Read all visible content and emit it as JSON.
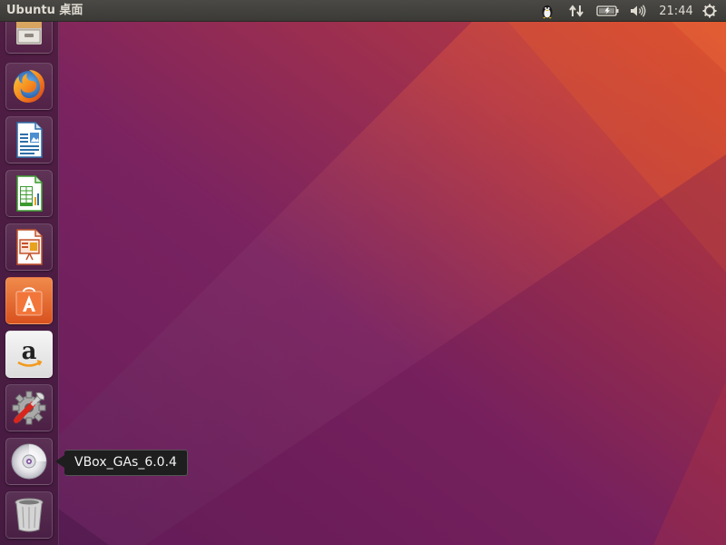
{
  "panel": {
    "title": "Ubuntu 桌面",
    "clock": "21:44",
    "indicators": [
      "qq-penguin-icon",
      "network-updown-icon",
      "battery-icon",
      "volume-icon",
      "power-gear-icon"
    ]
  },
  "launcher": {
    "items": [
      {
        "name": "files",
        "icon": "file-cabinet-icon"
      },
      {
        "name": "firefox",
        "icon": "firefox-icon"
      },
      {
        "name": "libreoffice-writer",
        "icon": "writer-document-icon"
      },
      {
        "name": "libreoffice-calc",
        "icon": "calc-spreadsheet-icon"
      },
      {
        "name": "libreoffice-impress",
        "icon": "impress-presentation-icon"
      },
      {
        "name": "ubuntu-software",
        "icon": "software-bag-icon"
      },
      {
        "name": "amazon",
        "icon": "amazon-icon"
      },
      {
        "name": "system-settings",
        "icon": "settings-wrench-gear-icon"
      },
      {
        "name": "vbox-cd",
        "icon": "optical-disc-icon"
      },
      {
        "name": "trash",
        "icon": "trash-icon"
      }
    ]
  },
  "tooltip": {
    "text": "VBox_GAs_6.0.4"
  },
  "colors": {
    "wallpaper_purple": "#6a1f5e",
    "wallpaper_orange": "#d4472a",
    "panel": "#3c3b37",
    "text": "#dfdbd2"
  }
}
